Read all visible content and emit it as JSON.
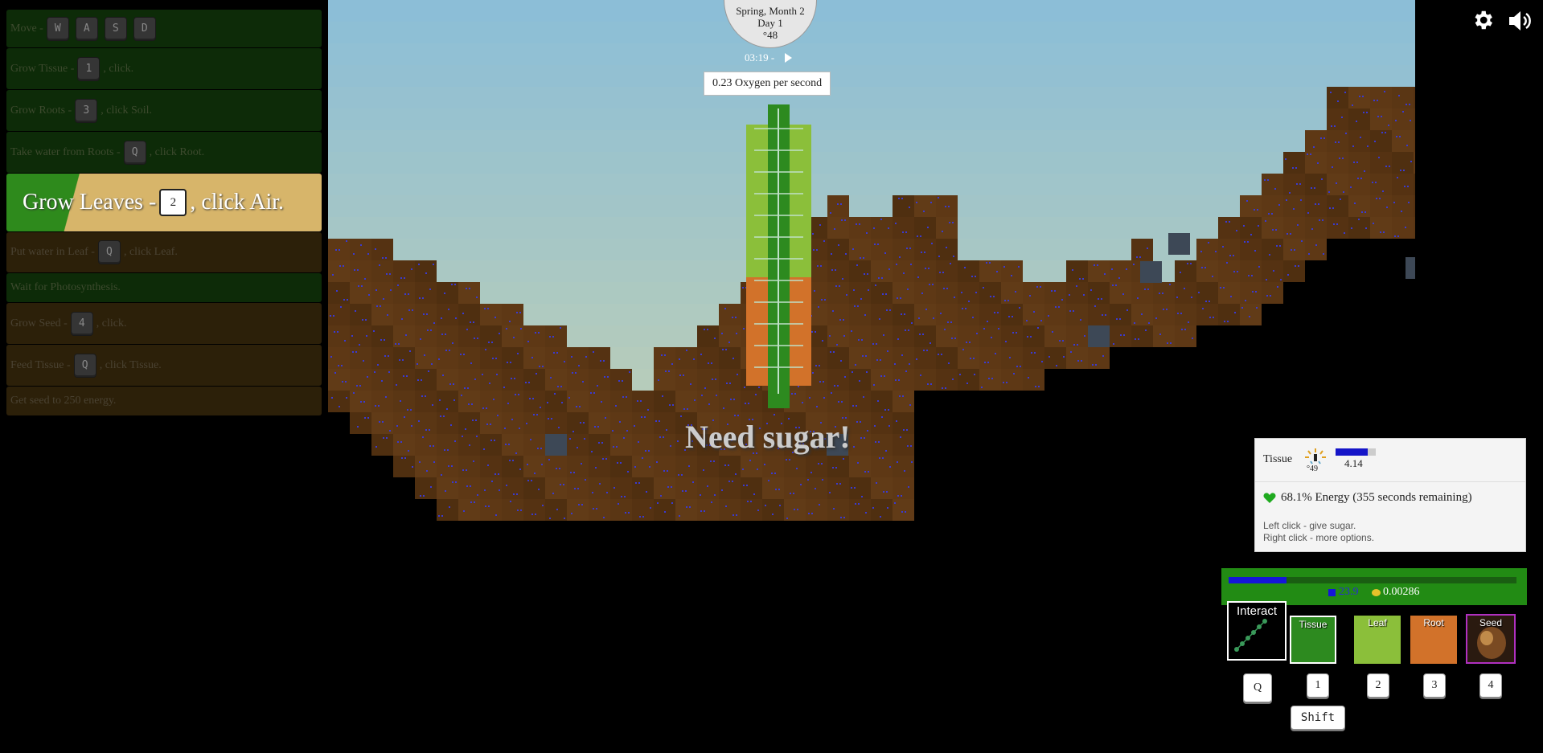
{
  "tutorial": [
    {
      "text_before": "Move -",
      "keys": [
        "W",
        "A",
        "S",
        "D"
      ],
      "text_after": "",
      "style": "green"
    },
    {
      "text_before": "Grow Tissue -",
      "keys": [
        "1"
      ],
      "text_after": ", click.",
      "style": "green"
    },
    {
      "text_before": "Grow Roots -",
      "keys": [
        "3"
      ],
      "text_after": ", click Soil.",
      "style": "green"
    },
    {
      "text_before": "Take water from Roots -",
      "keys": [
        "Q"
      ],
      "text_after": ", click Root.",
      "style": "green"
    },
    {
      "text_before": "Grow Leaves -",
      "keys": [
        "2"
      ],
      "text_after": ", click Air.",
      "style": "active"
    },
    {
      "text_before": "Put water in Leaf -",
      "keys": [
        "Q"
      ],
      "text_after": ", click Leaf.",
      "style": "brown"
    },
    {
      "text_before": "Wait for Photosynthesis.",
      "keys": [],
      "text_after": "",
      "style": "green"
    },
    {
      "text_before": "Grow Seed -",
      "keys": [
        "4"
      ],
      "text_after": ", click.",
      "style": "brown"
    },
    {
      "text_before": "Feed Tissue -",
      "keys": [
        "Q"
      ],
      "text_after": ", click Tissue.",
      "style": "brown"
    },
    {
      "text_before": "Get seed to 250 energy.",
      "keys": [],
      "text_after": "",
      "style": "brown"
    }
  ],
  "hud": {
    "season": "Spring, Month 2",
    "day": "Day 1",
    "temperature": "°48",
    "clock": "03:19 -",
    "oxygen": "0.23 Oxygen per second",
    "need_sugar": "Need sugar!"
  },
  "info": {
    "title": "Tissue",
    "temperature": "°49",
    "water_value": "4.14",
    "water_fraction": 0.8,
    "energy": "68.1% Energy (355 seconds remaining)",
    "hint_left": "Left click - give sugar.",
    "hint_right": "Right click - more options."
  },
  "resources": {
    "water": "23.9",
    "water_fraction": 0.2,
    "sugar": "0.00286"
  },
  "tools": {
    "interact": "Interact",
    "tissue": "Tissue",
    "leaf": "Leaf",
    "root": "Root",
    "seed": "Seed",
    "keys": {
      "interact": "Q",
      "tissue": "1",
      "leaf": "2",
      "root": "3",
      "seed": "4",
      "shift": "Shift"
    }
  },
  "colors": {
    "sky": "#a6cdd8",
    "soil": "#5a3614",
    "tissue": "#2d8a1f",
    "leaf": "#8bbf3a",
    "root": "#d2722a",
    "water": "#1515d8"
  },
  "icons": [
    "settings-gear-icon",
    "volume-icon",
    "play-icon",
    "heart-icon",
    "sun-icon",
    "water-icon",
    "sugar-icon"
  ]
}
